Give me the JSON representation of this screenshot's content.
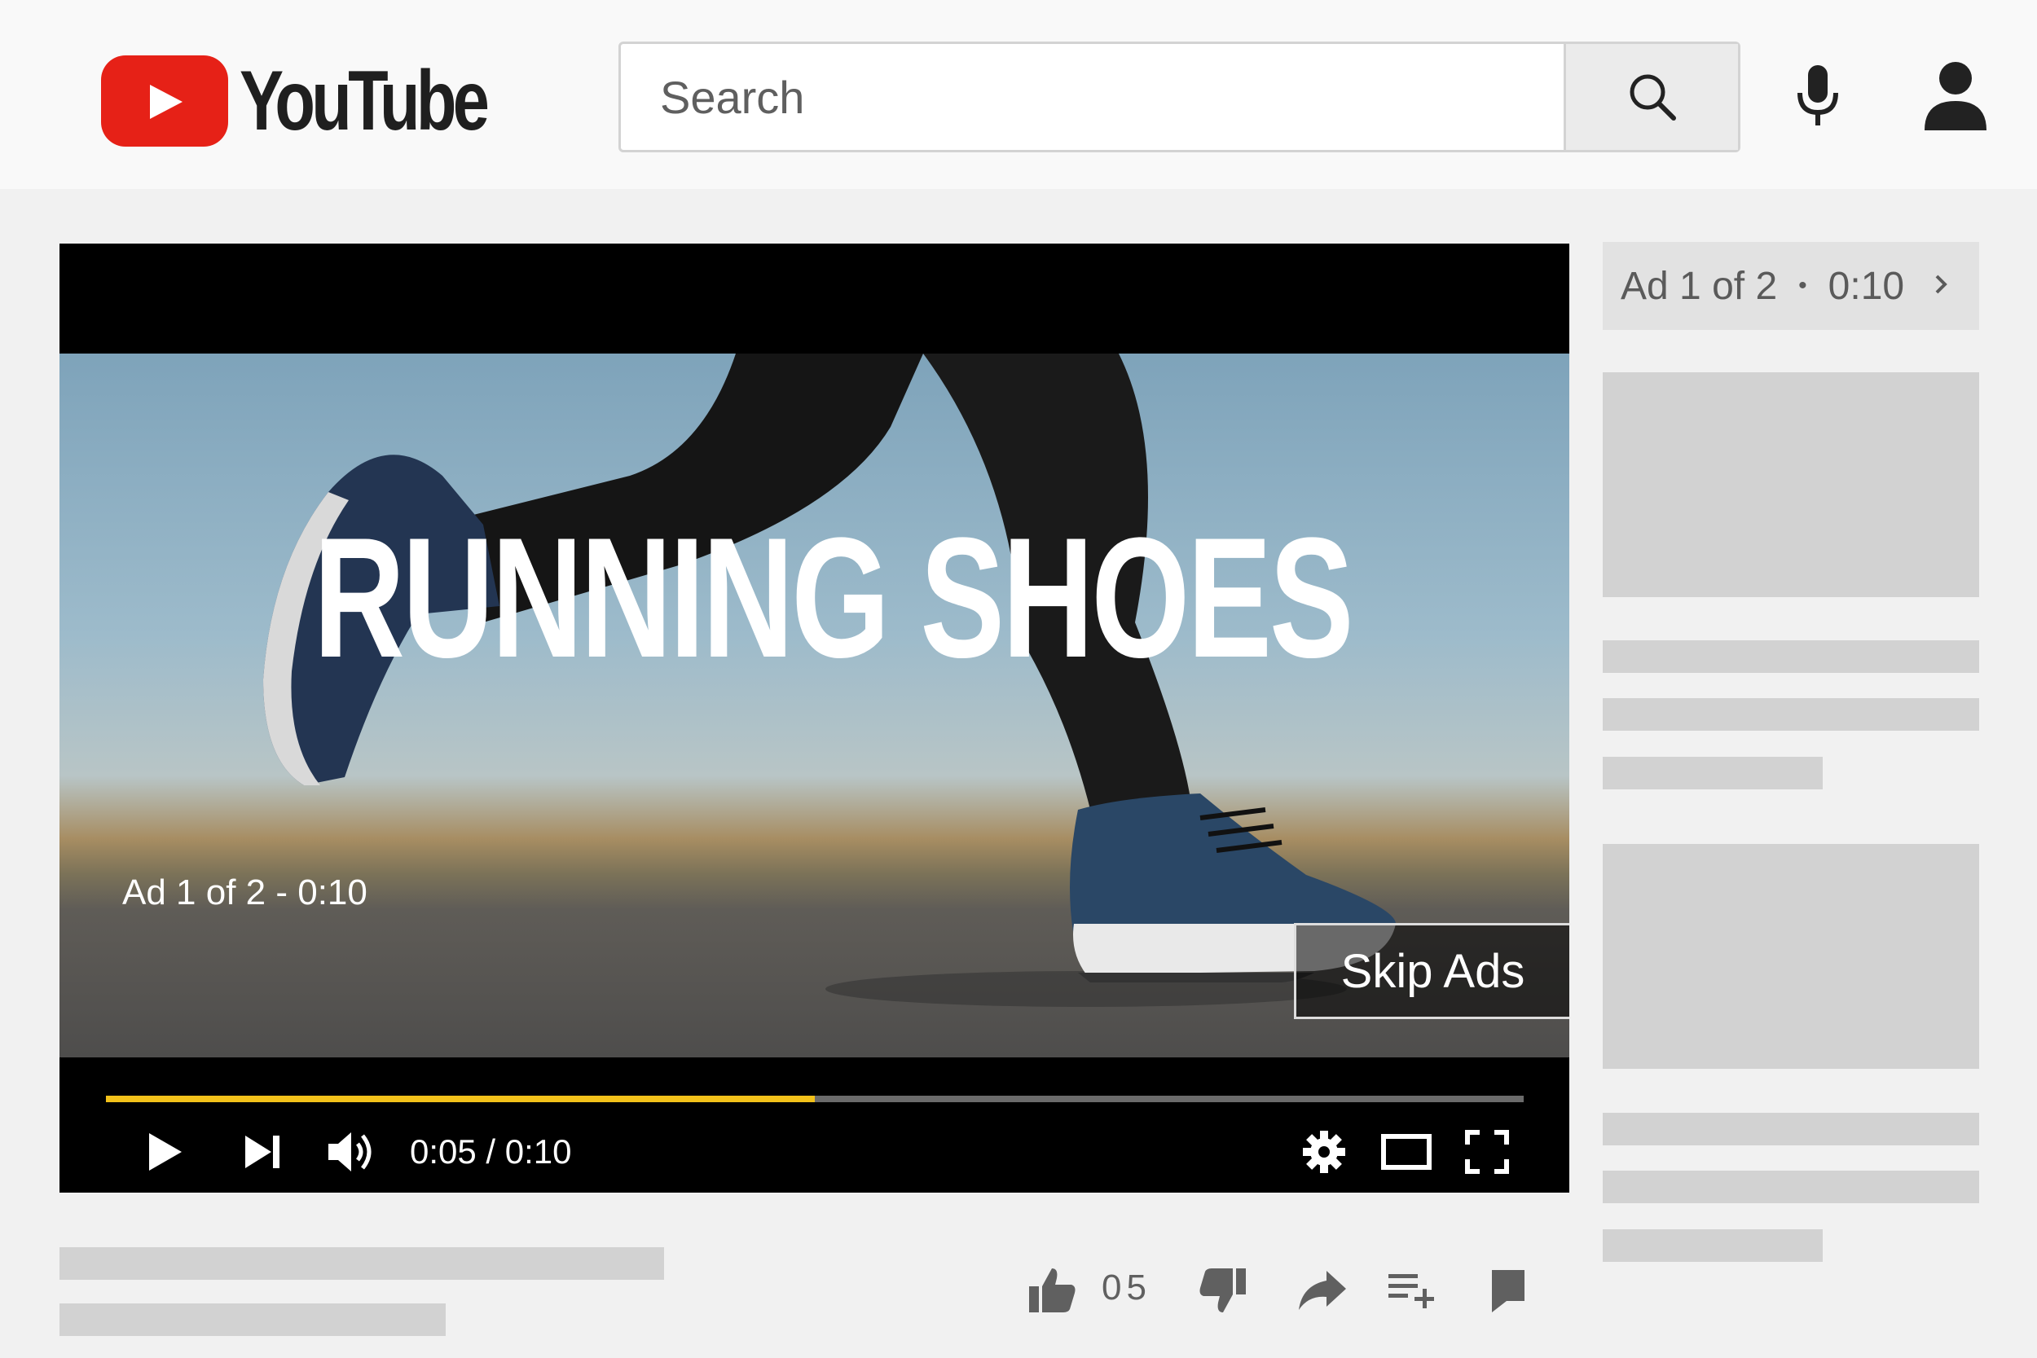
{
  "header": {
    "logo_text": "YouTube",
    "search_placeholder": "Search"
  },
  "player": {
    "ad_title": "RUNNING SHOES",
    "ad_counter": "Ad 1 of 2 - 0:10",
    "skip_label": "Skip Ads",
    "time_display": "0:05 / 0:10",
    "progress_fraction": 0.5
  },
  "sidebar": {
    "ad_label": "Ad 1 of 2",
    "dot": "•",
    "ad_time": "0:10"
  },
  "actions": {
    "likes": "05"
  },
  "colors": {
    "brand_red": "#e62117",
    "progress": "#f2c11a"
  }
}
